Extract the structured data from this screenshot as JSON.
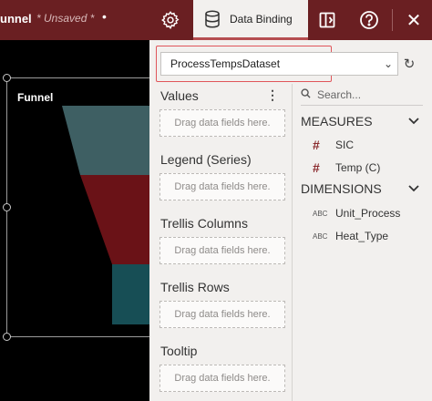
{
  "header": {
    "doc_title": "unnel",
    "unsaved": "* Unsaved *",
    "more": "•",
    "tab_label": "Data Binding",
    "close": "✕"
  },
  "chart": {
    "title": "Funnel",
    "colors": {
      "top": "#3e5f63",
      "mid": "#6a1217",
      "bottom": "#174e55"
    }
  },
  "dataset": {
    "selected": "ProcessTempsDataset",
    "chevron": "⌄",
    "refresh": "↻"
  },
  "binding": {
    "more": "⋮",
    "sections": [
      {
        "label": "Values",
        "drop": "Drag data fields here."
      },
      {
        "label": "Legend (Series)",
        "drop": "Drag data fields here."
      },
      {
        "label": "Trellis Columns",
        "drop": "Drag data fields here."
      },
      {
        "label": "Trellis Rows",
        "drop": "Drag data fields here."
      },
      {
        "label": "Tooltip",
        "drop": "Drag data fields here."
      }
    ]
  },
  "fields": {
    "search_placeholder": "Search...",
    "measures_label": "MEASURES",
    "dimensions_label": "DIMENSIONS",
    "measures": [
      {
        "type": "#",
        "name": "SIC"
      },
      {
        "type": "#",
        "name": "Temp (C)"
      }
    ],
    "dimensions": [
      {
        "type": "ABC",
        "name": "Unit_Process"
      },
      {
        "type": "ABC",
        "name": "Heat_Type"
      }
    ]
  },
  "colors": {
    "header_bg": "#6a1f22",
    "accent": "#e0555a",
    "panel_bg": "#f2f0ee"
  }
}
